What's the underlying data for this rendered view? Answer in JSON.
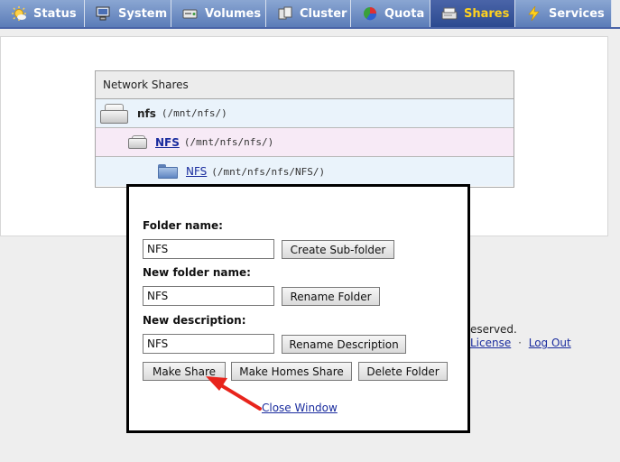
{
  "tabs": [
    {
      "label": "Status",
      "icon": "sun-icon",
      "active": false
    },
    {
      "label": "System",
      "icon": "computer-icon",
      "active": false
    },
    {
      "label": "Volumes",
      "icon": "disk-icon",
      "active": false
    },
    {
      "label": "Cluster",
      "icon": "cluster-icon",
      "active": false
    },
    {
      "label": "Quota",
      "icon": "pie-chart-icon",
      "active": false
    },
    {
      "label": "Shares",
      "icon": "drive-icon",
      "active": true
    },
    {
      "label": "Services",
      "icon": "lightning-icon",
      "active": false
    }
  ],
  "shares": {
    "header": "Network Shares",
    "rows": [
      {
        "name": "nfs",
        "path": "(/mnt/nfs/)"
      },
      {
        "name": "NFS",
        "path": "(/mnt/nfs/nfs/)"
      },
      {
        "name": "NFS",
        "path": "(/mnt/nfs/nfs/NFS/)"
      }
    ]
  },
  "footer": {
    "reserved_fragment": "eserved.",
    "license_link": "License",
    "separator": "·",
    "logout_link": "Log Out"
  },
  "popup": {
    "folder_name_label": "Folder name:",
    "folder_name_value": "NFS",
    "create_subfolder_button": "Create Sub-folder",
    "new_folder_name_label": "New folder name:",
    "new_folder_name_value": "NFS",
    "rename_folder_button": "Rename Folder",
    "new_description_label": "New description:",
    "new_description_value": "NFS",
    "rename_description_button": "Rename Description",
    "make_share_button": "Make Share",
    "make_homes_share_button": "Make Homes Share",
    "delete_folder_button": "Delete Folder",
    "close_window_link": "Close Window"
  },
  "annotation": {
    "arrow_color": "#e8241c"
  }
}
